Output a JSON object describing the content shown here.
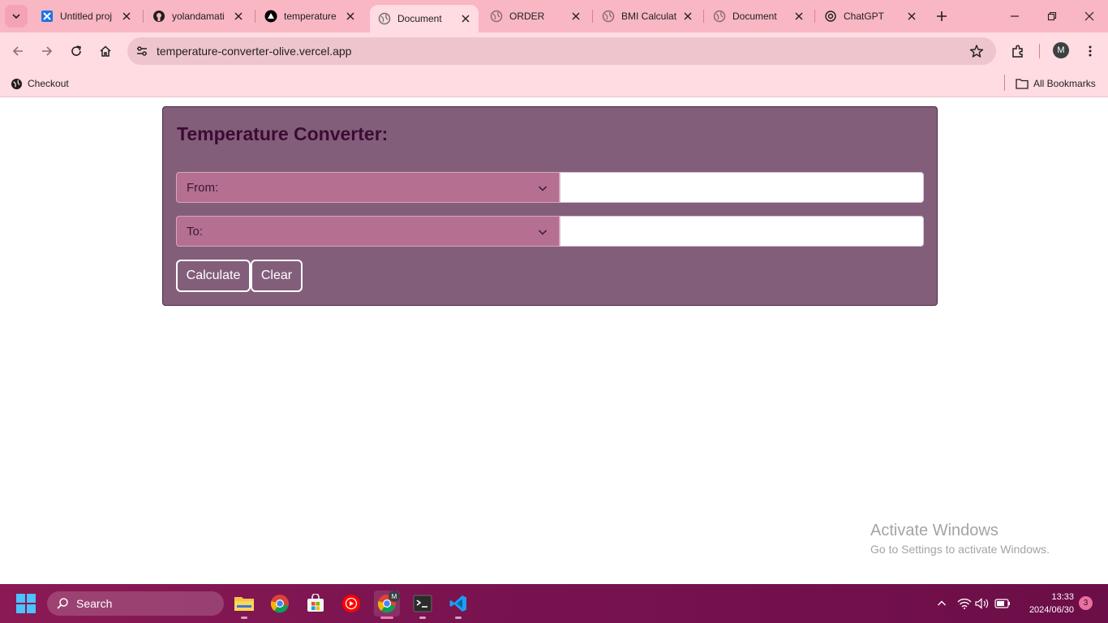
{
  "browser": {
    "tabs": [
      {
        "title": "Untitled proj",
        "favicon": "diagram-app-icon"
      },
      {
        "title": "yolandamati",
        "favicon": "github-icon"
      },
      {
        "title": "temperature",
        "favicon": "vercel-icon"
      },
      {
        "title": "Document",
        "favicon": "globe-icon",
        "active": true
      },
      {
        "title": "ORDER",
        "favicon": "globe-icon"
      },
      {
        "title": "BMI Calculat",
        "favicon": "globe-icon"
      },
      {
        "title": "Document",
        "favicon": "globe-icon"
      },
      {
        "title": "ChatGPT",
        "favicon": "openai-icon"
      }
    ],
    "url": "temperature-converter-olive.vercel.app",
    "profile_initial": "M",
    "bookmarks": [
      {
        "label": "Checkout",
        "icon": "globe-icon"
      }
    ],
    "all_bookmarks_label": "All Bookmarks",
    "theme_colors": {
      "tabstrip": "#f9b6c3",
      "toolbar": "#ffdbe2",
      "omnibox": "#efc5cd"
    }
  },
  "page": {
    "title": "Temperature Converter:",
    "from": {
      "label": "From:",
      "value": ""
    },
    "to": {
      "label": "To:",
      "value": ""
    },
    "calculate_label": "Calculate",
    "clear_label": "Clear",
    "colors": {
      "panel": "#835e7b",
      "select": "#b56f90",
      "heading": "#3b0b34"
    }
  },
  "watermark": {
    "line1": "Activate Windows",
    "line2": "Go to Settings to activate Windows."
  },
  "taskbar": {
    "search_label": "Search",
    "apps": [
      "file-explorer-icon",
      "chrome-icon",
      "microsoft-store-icon",
      "youtube-music-icon",
      "chrome-profile-icon",
      "terminal-icon",
      "vscode-icon"
    ],
    "profile_badge": "M",
    "time": "13:33",
    "date": "2024/06/30",
    "notification_count": "3"
  }
}
